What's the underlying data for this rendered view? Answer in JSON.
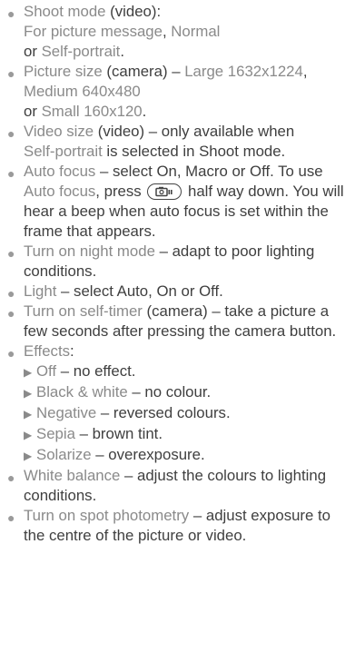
{
  "items": [
    {
      "kind": "shoot",
      "t1": "Shoot mode",
      "p1": " (video):",
      "t2": "For picture message",
      "p2": ", ",
      "t3": "Normal",
      "p3": " or ",
      "t4": "Self-portrait",
      "p4": "."
    },
    {
      "kind": "size",
      "t1": "Picture size",
      "p1": " (camera) – ",
      "t2": "Large 1632x1224",
      "p2": ", ",
      "t3": "Medium 640x480",
      "p3": " or ",
      "t4": "Small 160x120",
      "p4": "."
    },
    {
      "kind": "video",
      "t1": "Video size",
      "p1": " (video) – only available when ",
      "t2": "Self-portrait",
      "p2": " is selected in Shoot mode."
    },
    {
      "kind": "af",
      "t1": "Auto focus",
      "p1": " – select On, Macro or Off. To use ",
      "t2": "Auto focus",
      "p2": ", press ",
      "p3": " half way down. You will hear a beep when auto focus is set within the frame that appears.",
      "icon": "camera-key-icon"
    },
    {
      "kind": "simple",
      "t1": "Turn on night mode",
      "p1": " – adapt to poor lighting conditions."
    },
    {
      "kind": "simple",
      "t1": "Light",
      "p1": " – select Auto, On or Off."
    },
    {
      "kind": "simple",
      "t1": "Turn on self-timer",
      "p1": " (camera) – take a picture a few seconds after pressing the camera button."
    },
    {
      "kind": "effects",
      "t1": "Effects",
      "p1": ":",
      "sub": [
        {
          "t": "Off",
          "p": " – no effect."
        },
        {
          "t": "Black & white",
          "p": " – no colour."
        },
        {
          "t": "Negative",
          "p": " – reversed colours."
        },
        {
          "t": "Sepia",
          "p": " – brown tint."
        },
        {
          "t": "Solarize",
          "p": " – overexposure."
        }
      ]
    },
    {
      "kind": "simple",
      "t1": "White balance",
      "p1": " – adjust the colours to lighting conditions."
    },
    {
      "kind": "simple",
      "t1": "Turn on spot photometry",
      "p1": " – adjust exposure to the centre of the picture or video."
    }
  ],
  "colors": {
    "term": "#8a8a8a",
    "text": "#3f3f3f",
    "bullet": "#9a9a9a"
  }
}
